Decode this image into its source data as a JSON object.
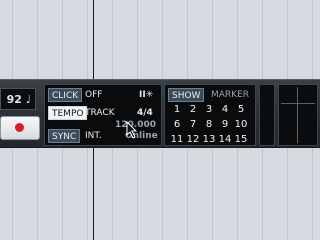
{
  "tempo": {
    "value": "92",
    "note_icon": "♩"
  },
  "record": {
    "label": ""
  },
  "click": {
    "label": "CLICK",
    "value": "OFF",
    "icon": "II✳"
  },
  "tempo_mode": {
    "label": "TEMPO",
    "source": "TRACK",
    "signature": "4/4",
    "bpm": "120.000"
  },
  "sync": {
    "label": "SYNC",
    "source": "INT.",
    "status": "Online"
  },
  "marker": {
    "show_label": "SHOW",
    "title": "MARKER",
    "numbers": [
      "1",
      "2",
      "3",
      "4",
      "5",
      "6",
      "7",
      "8",
      "9",
      "10",
      "11",
      "12",
      "13",
      "14",
      "15"
    ]
  }
}
